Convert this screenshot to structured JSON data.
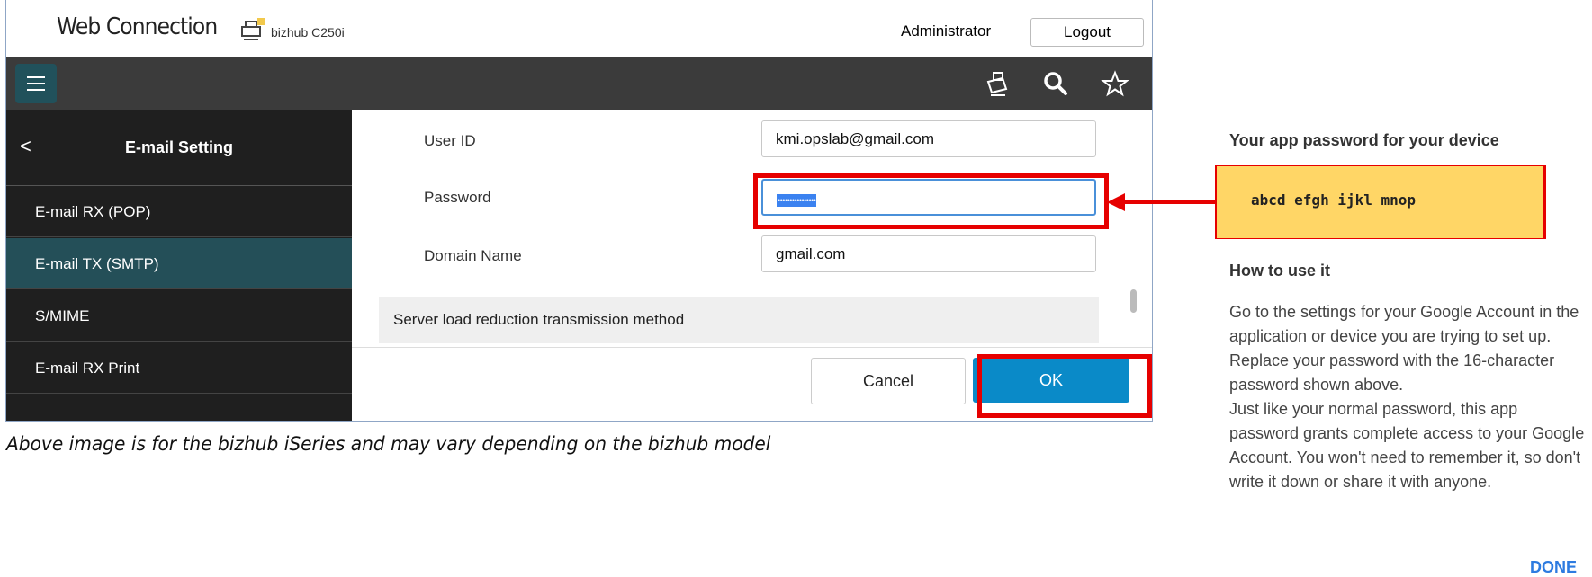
{
  "header": {
    "brand": "Web Connection",
    "device_name": "bizhub C250i",
    "user": "Administrator",
    "logout_label": "Logout"
  },
  "toolbar": {
    "icons": [
      "menu-icon",
      "device-icon",
      "search-icon",
      "star-icon"
    ]
  },
  "sidebar": {
    "back_icon": "<",
    "title": "E-mail Setting",
    "items": [
      {
        "label": "E-mail RX (POP)",
        "active": false
      },
      {
        "label": "E-mail TX (SMTP)",
        "active": true
      },
      {
        "label": "S/MIME",
        "active": false
      },
      {
        "label": "E-mail RX Print",
        "active": false
      }
    ]
  },
  "form": {
    "user_id": {
      "label": "User ID",
      "value": "kmi.opslab@gmail.com"
    },
    "password": {
      "label": "Password",
      "value": "••••••••••••••••"
    },
    "domain": {
      "label": "Domain Name",
      "value": "gmail.com"
    },
    "section": "Server load reduction transmission method",
    "cancel_label": "Cancel",
    "ok_label": "OK"
  },
  "caption": "Above image is for the bizhub iSeries and may vary depending on the bizhub model",
  "app_password": {
    "title": "Your app password for your device",
    "code": "abcd efgh ijkl mnop",
    "how_title": "How to use it",
    "how_text_1": "Go to the settings for your Google Account in the application or device you are trying to set up. Replace your password with the 16-character password shown above.",
    "how_text_2": "Just like your normal password, this app password grants complete access to your Google Account. You won't need to remember it, so don't write it down or share it with anyone.",
    "done_label": "DONE"
  },
  "colors": {
    "highlight": "#e60000",
    "ok_button": "#0a8ac8",
    "sidebar_active": "#244f58",
    "code_background": "#ffd666"
  }
}
